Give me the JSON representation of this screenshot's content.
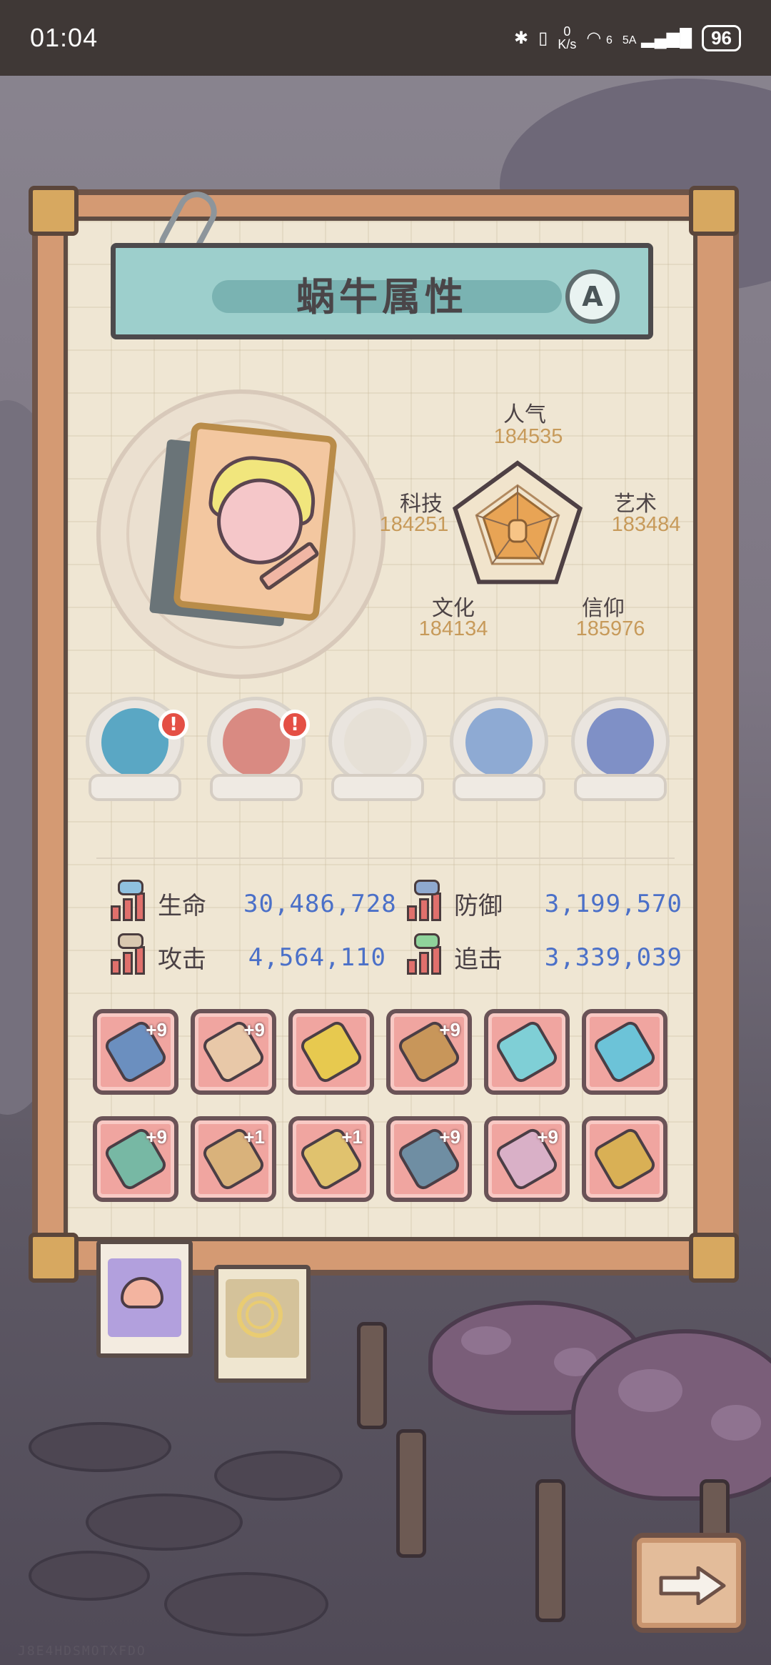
{
  "status_bar": {
    "time": "01:04",
    "bluetooth": "✱",
    "network_speed": "0\nK/s",
    "wifi": "6",
    "signal": "5A",
    "battery": "96"
  },
  "panel": {
    "title": "蜗牛属性",
    "grade": "A"
  },
  "radar_stats": [
    {
      "name": "人气",
      "value": "184535"
    },
    {
      "name": "艺术",
      "value": "183484"
    },
    {
      "name": "信仰",
      "value": "185976"
    },
    {
      "name": "文化",
      "value": "184134"
    },
    {
      "name": "科技",
      "value": "184251"
    }
  ],
  "radar_values": [
    184535,
    183484,
    185976,
    184134,
    184251
  ],
  "pets": [
    {
      "icon": "blue-fish-monster-icon",
      "color": "#5aa7c4",
      "alert": "!"
    },
    {
      "icon": "red-toothed-monster-icon",
      "color": "#d98a82",
      "alert": "!"
    },
    {
      "icon": "empty-shell-slot-icon",
      "color": "#e6e0d6",
      "alert": ""
    },
    {
      "icon": "compass-icon",
      "color": "#8eaad3",
      "alert": ""
    },
    {
      "icon": "colored-cubes-icon",
      "color": "#7f90c6",
      "alert": ""
    }
  ],
  "combat_stats": [
    {
      "label": "生命",
      "value": "30,486,728",
      "icon": "health-icon",
      "color": "#8fc1e0"
    },
    {
      "label": "防御",
      "value": "3,199,570",
      "icon": "defense-icon",
      "color": "#8fa9cf"
    },
    {
      "label": "攻击",
      "value": "4,564,110",
      "icon": "attack-icon",
      "color": "#d9c8b0"
    },
    {
      "label": "追击",
      "value": "3,339,039",
      "icon": "pursuit-icon",
      "color": "#8fd39b"
    }
  ],
  "equipment": [
    {
      "icon": "ring-bracer-icon",
      "level": "+9",
      "color": "#6b8fbf"
    },
    {
      "icon": "leg-armor-icon",
      "level": "+9",
      "color": "#e8c8a8"
    },
    {
      "icon": "gold-amulet-icon",
      "level": "",
      "color": "#e7c94f"
    },
    {
      "icon": "slingshot-icon",
      "level": "+9",
      "color": "#c8965a"
    },
    {
      "icon": "crystal-blade-icon",
      "level": "",
      "color": "#7fcfd6"
    },
    {
      "icon": "crystal-staff-icon",
      "level": "",
      "color": "#6cc3d8"
    },
    {
      "icon": "trident-icon",
      "level": "+9",
      "color": "#77b8a4"
    },
    {
      "icon": "mech-armor-icon",
      "level": "+1",
      "color": "#d9b27b"
    },
    {
      "icon": "gold-mask-icon",
      "level": "+1",
      "color": "#e0c26e"
    },
    {
      "icon": "gauntlet-icon",
      "level": "+9",
      "color": "#6f8ea3"
    },
    {
      "icon": "rocket-sword-icon",
      "level": "+9",
      "color": "#d9b0c7"
    },
    {
      "icon": "golden-sword-icon",
      "level": "",
      "color": "#d9b055"
    }
  ],
  "tabs": [
    {
      "name": "snail-tab",
      "icon": "snail-face-icon"
    },
    {
      "name": "shell-tab",
      "icon": "shell-icon"
    }
  ],
  "next_button": {
    "icon": "arrow-right-icon"
  },
  "watermark": "J8E4HDSMOTXFDO",
  "colors": {
    "accent": "#4b70c8",
    "header": "#9dcfcc",
    "radar_fill": "#e8a455",
    "stat_value": "#c79a5a"
  }
}
